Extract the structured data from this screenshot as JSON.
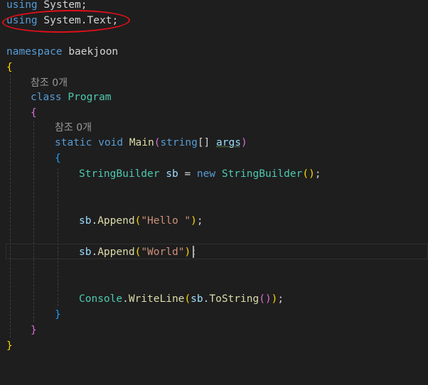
{
  "code": {
    "line1": {
      "kw": "using",
      "ns": "System",
      "semi": ";"
    },
    "line2": {
      "kw": "using",
      "ns": "System",
      "dot": ".",
      "ns2": "Text",
      "semi": ";"
    },
    "line3": {
      "kw": "namespace",
      "name": "baekjoon"
    },
    "brace_open_ns": "{",
    "lens_class": "참조 0개",
    "class_kw": "class",
    "class_name": "Program",
    "brace_open_class": "{",
    "lens_main": "참조 0개",
    "main_sig": {
      "static": "static",
      "void": "void",
      "name": "Main",
      "lp": "(",
      "type": "string",
      "arr": "[]",
      "arg": "args",
      "rp": ")"
    },
    "brace_open_main": "{",
    "sb_decl": {
      "type": "StringBuilder",
      "var": "sb",
      "eq": "=",
      "new": "new",
      "ctor": "StringBuilder",
      "lp": "(",
      "rp": ")",
      "semi": ";"
    },
    "append1": {
      "obj": "sb",
      "dot": ".",
      "method": "Append",
      "lp": "(",
      "arg": "\"Hello \"",
      "rp": ")",
      "semi": ";"
    },
    "append2": {
      "obj": "sb",
      "dot": ".",
      "method": "Append",
      "lp": "(",
      "arg": "\"World\"",
      "rp": ")",
      "semi": ";"
    },
    "writeline": {
      "cls": "Console",
      "dot1": ".",
      "method": "WriteLine",
      "lp": "(",
      "obj": "sb",
      "dot2": ".",
      "tostring": "ToString",
      "lp2": "(",
      "rp2": ")",
      "rp": ")",
      "semi": ";"
    },
    "brace_close_main": "}",
    "brace_close_class": "}",
    "brace_close_ns": "}"
  },
  "colors": {
    "background": "#1e1e1e",
    "keyword": "#569cd6",
    "type": "#4ec9b0",
    "method": "#dcdcaa",
    "variable": "#9cdcfe",
    "string": "#ce9178",
    "annotation": "#e0101a"
  }
}
